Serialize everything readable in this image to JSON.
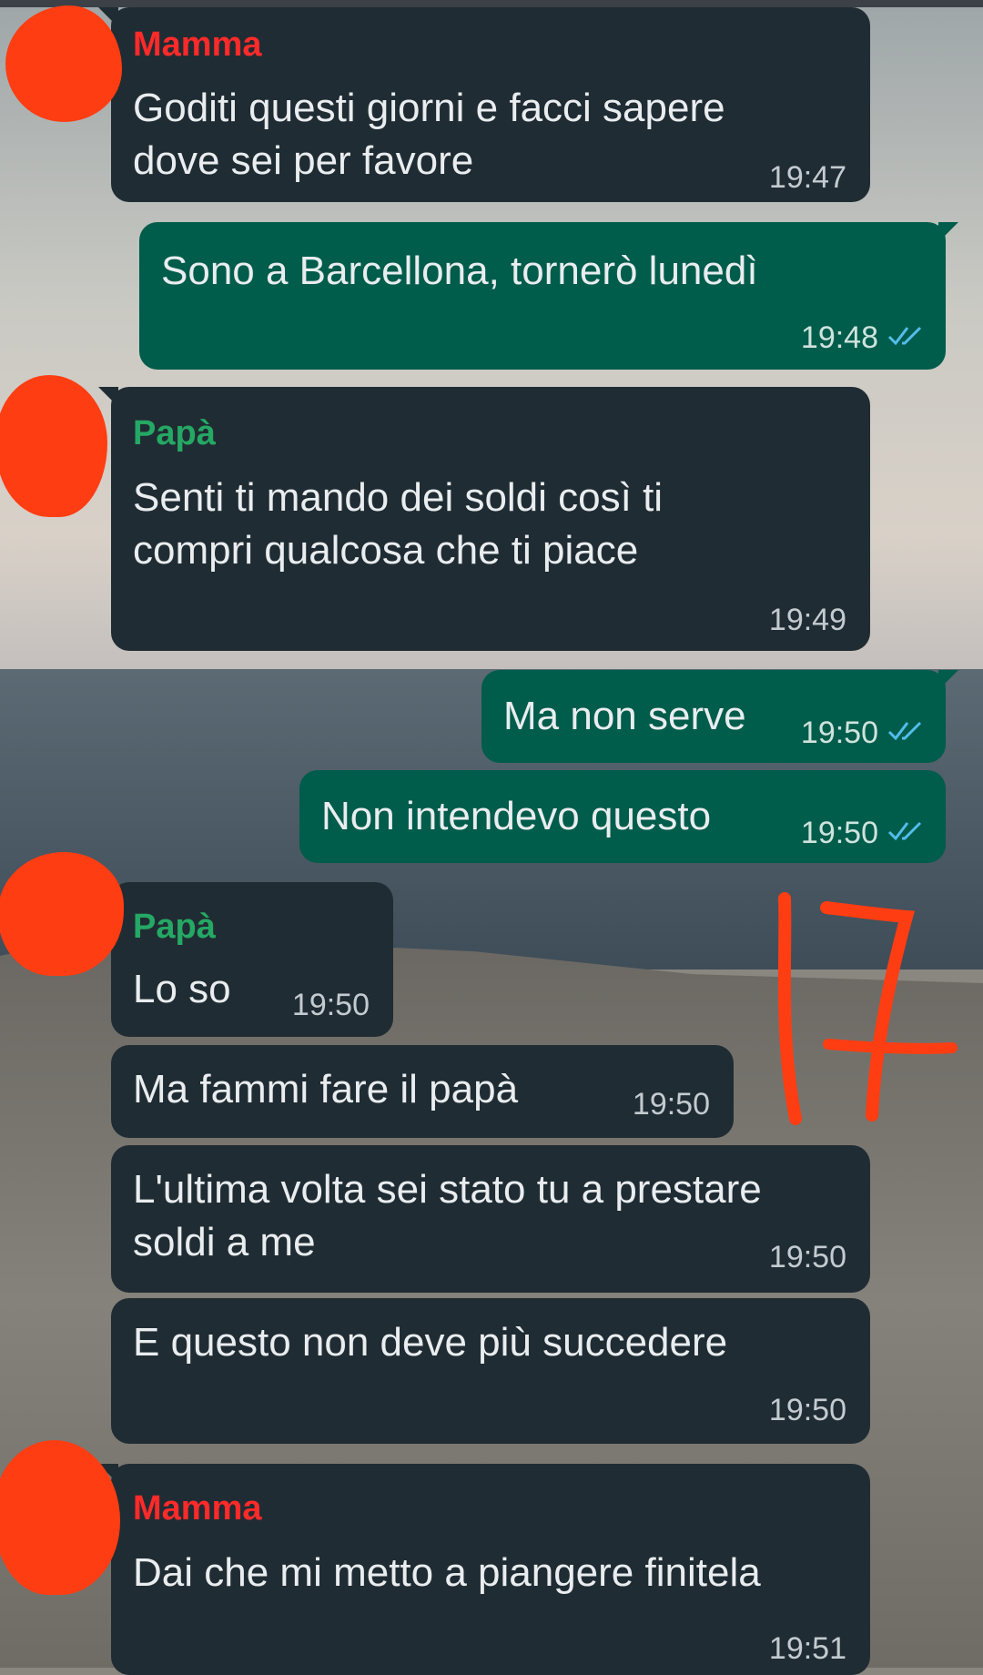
{
  "chat": {
    "colors": {
      "incoming_bubble": "#202c33",
      "outgoing_bubble": "#005c4b",
      "read_ticks": "#53bdeb",
      "mamma_name": "#ff2a2a",
      "papa_name": "#25a864",
      "scribble": "#ff3d12"
    },
    "messages": [
      {
        "sender": "Mamma",
        "text": "Goditi questi giorni e facci sapere\ndove sei per favore",
        "time": "19:47"
      },
      {
        "text": "Sono a Barcellona, tornerò lunedì",
        "time": "19:48",
        "status": "read"
      },
      {
        "sender": "Papà",
        "text": "Senti ti mando dei soldi così ti\ncompri qualcosa che ti piace",
        "time": "19:49"
      },
      {
        "text": "Ma non serve",
        "time": "19:50",
        "status": "read"
      },
      {
        "text": "Non intendevo questo",
        "time": "19:50",
        "status": "read"
      },
      {
        "sender": "Papà",
        "text": "Lo so",
        "time": "19:50"
      },
      {
        "text": "Ma fammi fare il papà",
        "time": "19:50"
      },
      {
        "text": "L'ultima volta sei stato tu a prestare\nsoldi a me",
        "time": "19:50"
      },
      {
        "text": "E questo non deve più succedere",
        "time": "19:50"
      },
      {
        "sender": "Mamma",
        "text": "Dai che mi metto a piangere finitela",
        "time": "19:51"
      }
    ],
    "annotation": "17"
  }
}
